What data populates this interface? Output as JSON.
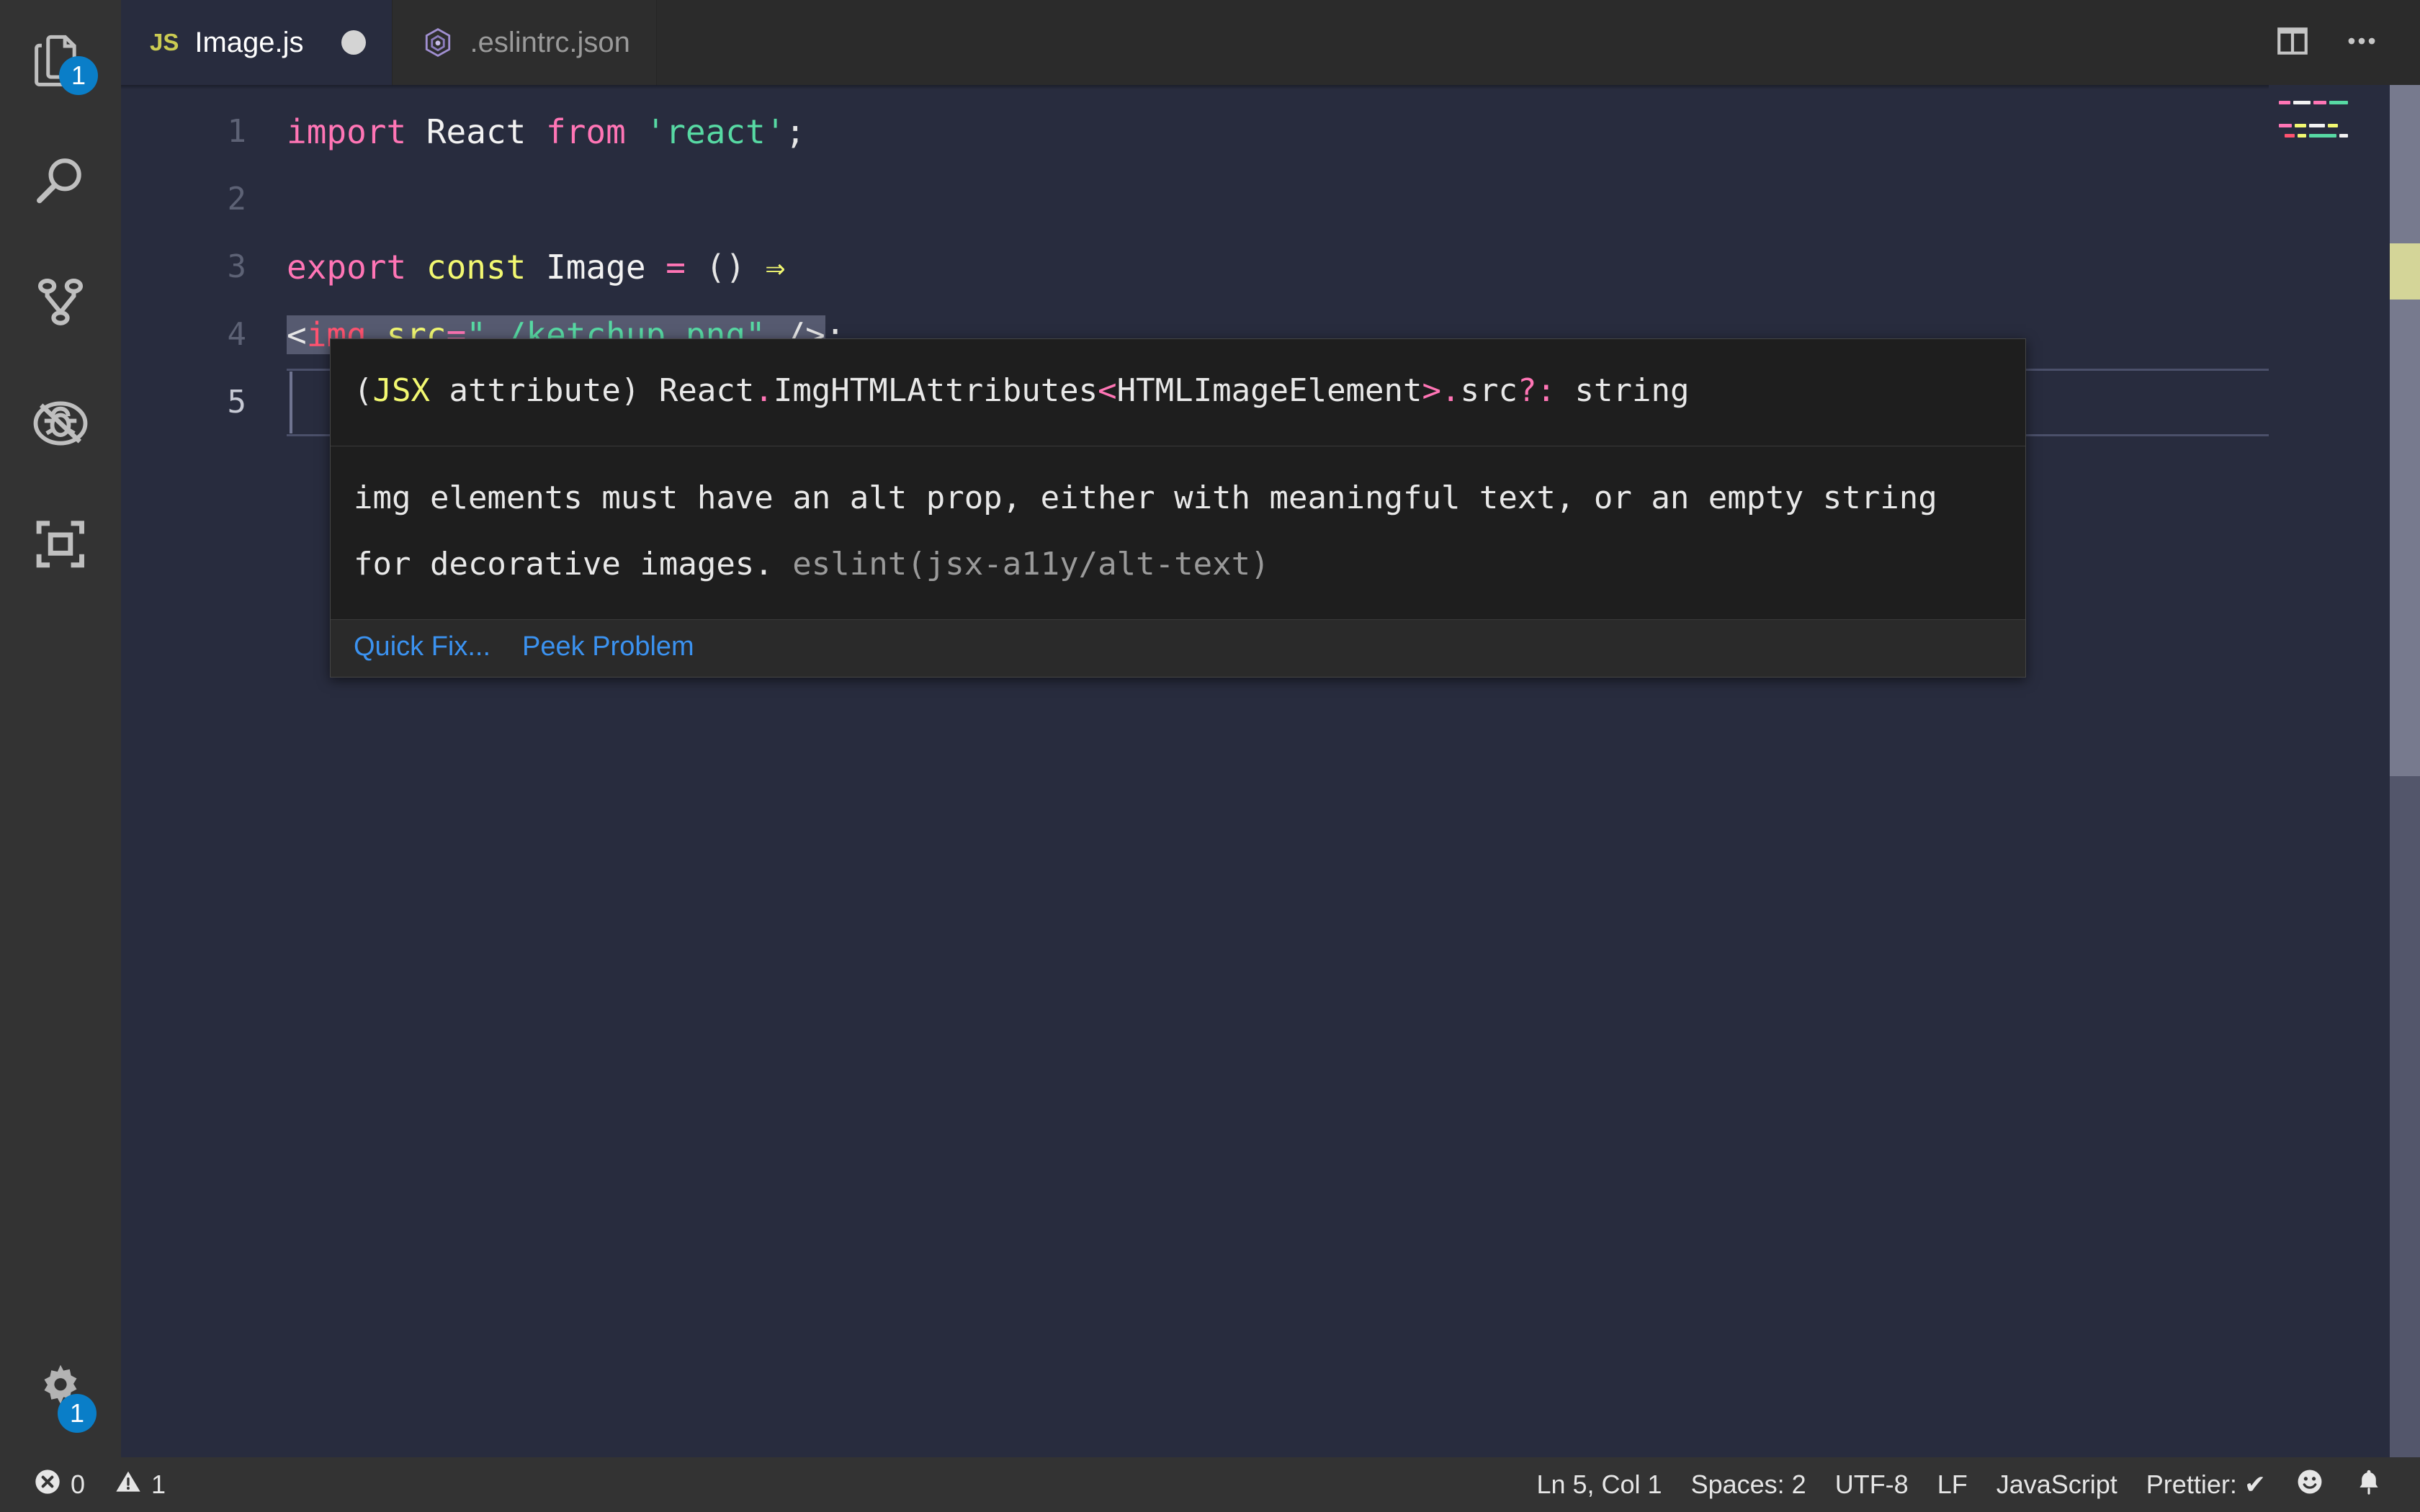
{
  "activity_bar": {
    "items": [
      {
        "name": "explorer",
        "icon": "files-icon",
        "badge": "1"
      },
      {
        "name": "search",
        "icon": "search-icon",
        "badge": null
      },
      {
        "name": "source-control",
        "icon": "source-control-icon",
        "badge": null
      },
      {
        "name": "run-and-debug",
        "icon": "run-debug-icon",
        "badge": null
      },
      {
        "name": "extensions",
        "icon": "extensions-icon",
        "badge": null
      }
    ],
    "bottom": {
      "name": "manage-settings",
      "icon": "gear-icon",
      "badge": "1"
    }
  },
  "tabs": [
    {
      "label": "Image.js",
      "icon": "js-file-icon",
      "icon_text": "JS",
      "active": true,
      "dirty": true
    },
    {
      "label": ".eslintrc.json",
      "icon": "eslint-file-icon",
      "active": false,
      "dirty": false
    }
  ],
  "tab_actions": [
    {
      "name": "split-editor-icon",
      "label": "Split Editor"
    },
    {
      "name": "more-actions-icon",
      "label": "More Actions..."
    }
  ],
  "editor": {
    "lines": [
      {
        "num": "1",
        "tokens": [
          {
            "t": "import",
            "c": "t-kw"
          },
          {
            "t": " ",
            "c": "t-def"
          },
          {
            "t": "React",
            "c": "t-def"
          },
          {
            "t": " ",
            "c": "t-def"
          },
          {
            "t": "from",
            "c": "t-kw"
          },
          {
            "t": " ",
            "c": "t-def"
          },
          {
            "t": "'react'",
            "c": "t-str"
          },
          {
            "t": ";",
            "c": "t-punct"
          }
        ]
      },
      {
        "num": "2",
        "tokens": []
      },
      {
        "num": "3",
        "tokens": [
          {
            "t": "export",
            "c": "t-kw"
          },
          {
            "t": " ",
            "c": "t-def"
          },
          {
            "t": "const",
            "c": "t-var"
          },
          {
            "t": " ",
            "c": "t-def"
          },
          {
            "t": "Image",
            "c": "t-def"
          },
          {
            "t": " ",
            "c": "t-def"
          },
          {
            "t": "=",
            "c": "t-op"
          },
          {
            "t": " ",
            "c": "t-def"
          },
          {
            "t": "()",
            "c": "t-punct"
          },
          {
            "t": " ",
            "c": "t-def"
          },
          {
            "t": "⇒",
            "c": "t-var"
          }
        ]
      },
      {
        "num": "4",
        "selected_text": "<img src=\"./ketchup.png\" />",
        "trailing": ";",
        "tokens": [
          {
            "t": "<",
            "c": "t-punct"
          },
          {
            "t": "img",
            "c": "t-tag"
          },
          {
            "t": " ",
            "c": "t-def"
          },
          {
            "t": "src",
            "c": "t-var"
          },
          {
            "t": "=",
            "c": "t-op"
          },
          {
            "t": "\"./ketchup.png\"",
            "c": "t-str"
          },
          {
            "t": " ",
            "c": "t-def"
          },
          {
            "t": "/>",
            "c": "t-punct"
          }
        ]
      },
      {
        "num": "5",
        "tokens": []
      }
    ],
    "current_line": "5"
  },
  "hover": {
    "signature": {
      "prefix_paren_open": "(",
      "jsx_kw": "JSX",
      "attribute_kw": " attribute",
      "prefix_paren_close": ") ",
      "react_ns": "React",
      "dot1": ".",
      "type_name": "ImgHTMLAttributes",
      "angle_open": "<",
      "generic": "HTMLImageEleme",
      "generic_wrap": "nt",
      "angle_close": ">",
      "dot2": ".",
      "prop": "src",
      "optional": "?:",
      "value_type": " string"
    },
    "message": "img elements must have an alt prop, either with meaningful text, or an empty string for decorative images.",
    "rule": "eslint(jsx-a11y/alt-text)",
    "actions": [
      {
        "label": "Quick Fix...",
        "name": "quick-fix-link"
      },
      {
        "label": "Peek Problem",
        "name": "peek-problem-link"
      }
    ]
  },
  "status_bar": {
    "left": [
      {
        "name": "error-count",
        "icon": "error-circle-icon",
        "value": "0"
      },
      {
        "name": "warning-count",
        "icon": "warning-triangle-icon",
        "value": "1"
      }
    ],
    "right": [
      {
        "name": "cursor-position",
        "label": "Ln 5, Col 1"
      },
      {
        "name": "indentation",
        "label": "Spaces: 2"
      },
      {
        "name": "encoding",
        "label": "UTF-8"
      },
      {
        "name": "eol",
        "label": "LF"
      },
      {
        "name": "language-mode",
        "label": "JavaScript"
      },
      {
        "name": "prettier-status",
        "label": "Prettier: ✔"
      }
    ],
    "icons": [
      {
        "name": "feedback-smiley-icon"
      },
      {
        "name": "notifications-bell-icon"
      }
    ]
  },
  "colors": {
    "editor_bg": "#282c3e",
    "activity_bar_bg": "#333333",
    "tabbar_bg": "#2b2b2b",
    "active_tab_bg": "#282c3e",
    "inactive_tab_bg": "#2d2d2d",
    "status_bar_bg": "#333333",
    "badge_blue": "#0a7ec8",
    "link_blue": "#3b92f0",
    "selection": "#565a70",
    "warning_yellow": "#e0e07a",
    "hover_bg": "#1e1e1e",
    "keyword_pink": "#ff75b5",
    "string_green": "#57d9a3",
    "var_yellow": "#f2f871",
    "tag_red": "#ff5370"
  }
}
